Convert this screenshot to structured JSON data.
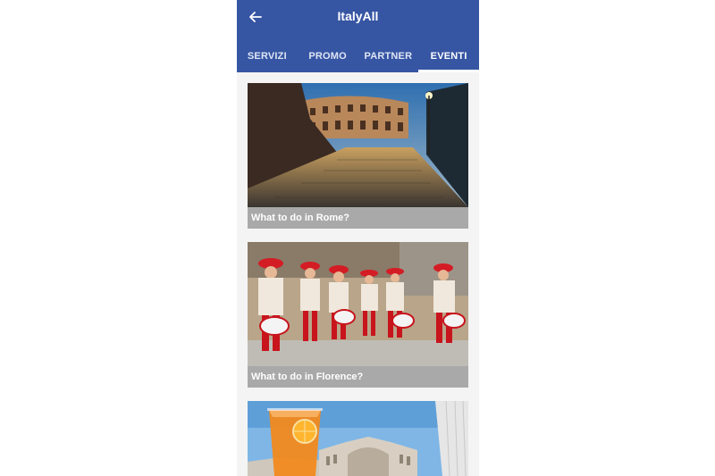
{
  "app": {
    "title": "ItalyAll"
  },
  "icons": {
    "back": "arrow-left-icon"
  },
  "tabs": [
    {
      "label": "SERVIZI",
      "active": false
    },
    {
      "label": "PROMO",
      "active": false
    },
    {
      "label": "PARTNER",
      "active": false
    },
    {
      "label": "EVENTI",
      "active": true
    }
  ],
  "events": [
    {
      "caption": "What to do in Rome?"
    },
    {
      "caption": "What to do in Florence?"
    },
    {
      "caption": ""
    }
  ],
  "colors": {
    "primary": "#3655a3",
    "caption_bg": "#a9a9a9"
  }
}
